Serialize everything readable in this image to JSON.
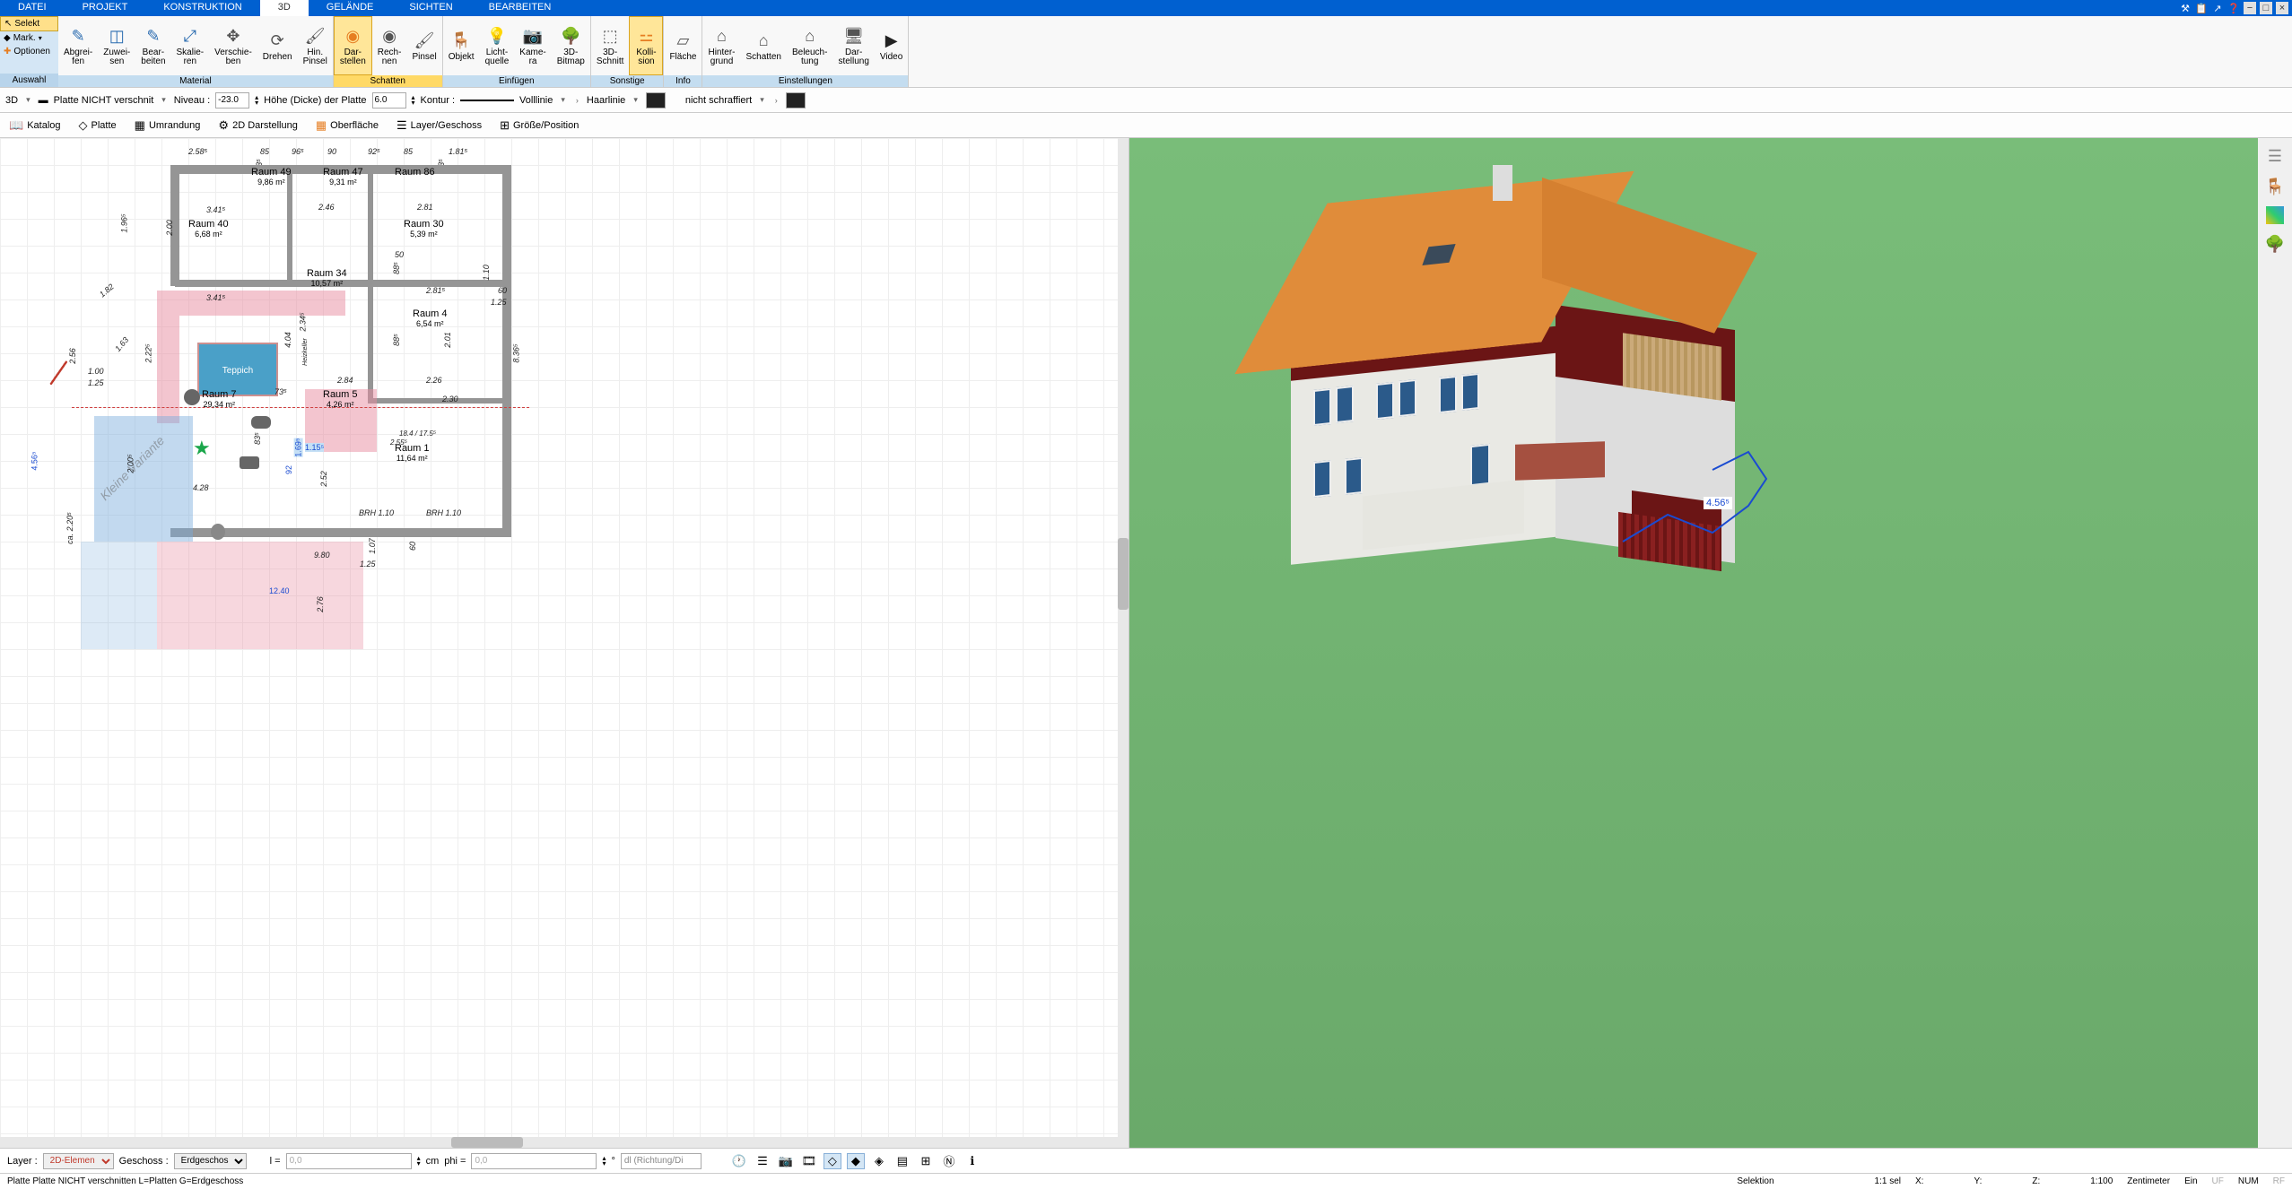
{
  "menu": {
    "datei": "DATEI",
    "projekt": "PROJEKT",
    "konstruktion": "KONSTRUKTION",
    "d3": "3D",
    "gelaende": "GELÄNDE",
    "sichten": "SICHTEN",
    "bearbeiten": "BEARBEITEN"
  },
  "side": {
    "selekt": "Selekt",
    "mark": "Mark.",
    "optionen": "Optionen",
    "auswahl": "Auswahl"
  },
  "ribbon": {
    "material": {
      "label": "Material",
      "abgreifen": "Abgrei-\nfen",
      "zuweisen": "Zuwei-\nsen",
      "bearbeiten": "Bear-\nbeiten",
      "skalieren": "Skalie-\nren",
      "verschieben": "Verschie-\nben",
      "drehen": "Drehen",
      "hinpinsel": "Hin.\nPinsel"
    },
    "schatten": {
      "label": "Schatten",
      "darstellen": "Dar-\nstellen",
      "rechnen": "Rech-\nnen",
      "pinsel": "Pinsel"
    },
    "einfuegen": {
      "label": "Einfügen",
      "objekt": "Objekt",
      "lichtquelle": "Licht-\nquelle",
      "kamera": "Kame-\nra",
      "bitmap3d": "3D-\nBitmap"
    },
    "sonstige": {
      "label": "Sonstige",
      "schnitt3d": "3D-\nSchnitt",
      "kollision": "Kolli-\nsion"
    },
    "info": {
      "label": "Info",
      "flaeche": "Fläche"
    },
    "einstellungen": {
      "label": "Einstellungen",
      "hintergrund": "Hinter-\ngrund",
      "schatten2": "Schatten",
      "beleuchtung": "Beleuch-\ntung",
      "darstellung": "Dar-\nstellung",
      "video": "Video"
    }
  },
  "props": {
    "d3": "3D",
    "platte": "Platte NICHT verschnit",
    "niveau": "Niveau :",
    "niveau_val": "-23.0",
    "hoehe": "Höhe (Dicke) der Platte",
    "hoehe_val": "6.0",
    "kontur": "Kontur :",
    "volllinie": "Volllinie",
    "haarlinie": "Haarlinie",
    "nicht_schraff": "nicht schraffiert"
  },
  "tabs": {
    "katalog": "Katalog",
    "platte": "Platte",
    "umrandung": "Umrandung",
    "darstellung2d": "2D Darstellung",
    "oberflaeche": "Oberfläche",
    "layergeschoss": "Layer/Geschoss",
    "groesseposition": "Größe/Position"
  },
  "plan": {
    "teppich": "Teppich",
    "variante": "Kleine\nVariante",
    "rooms": {
      "r40": {
        "name": "Raum 40",
        "area": "6,68 m²"
      },
      "r47": {
        "name": "Raum 47",
        "area": "9,31 m²"
      },
      "r49": {
        "name": "Raum 49",
        "area": "9,86 m²"
      },
      "r86": {
        "name": "Raum 86",
        "area": ""
      },
      "r30": {
        "name": "Raum 30",
        "area": "5,39 m²"
      },
      "r34": {
        "name": "Raum 34",
        "area": "10,57 m²"
      },
      "r4": {
        "name": "Raum 4",
        "area": "6,54 m²"
      },
      "r5": {
        "name": "Raum 5",
        "area": "4,26 m²"
      },
      "r1": {
        "name": "Raum 1",
        "area": "11,64 m²"
      },
      "r7": {
        "name": "Raum 7",
        "area": "29,34 m²"
      }
    },
    "dims": {
      "d258": "2.58⁵",
      "d85a": "85",
      "d96": "96⁵",
      "d90": "90",
      "d92": "92⁵",
      "d85b": "85",
      "d181": "1.81⁵",
      "d341": "3.41⁵",
      "d246": "2.46",
      "d281": "2.81",
      "d200": "2.00",
      "d196": "1.96⁵",
      "d182": "1.82",
      "d456": "4.56⁵",
      "d404": "4.04",
      "d234": "2.34⁵",
      "d284": "2.84",
      "d226": "2.26",
      "d230": "2.30",
      "d201": "2.01",
      "d125a": "1.25",
      "d163": "1.63",
      "d225": "2.22⁵",
      "d256": "2.56",
      "d100": "1.00",
      "d125b": "1.25",
      "d428": "4.28",
      "d980": "9.80",
      "d1240": "12.40",
      "d252": "2.52",
      "d107": "1.07",
      "d60": "60",
      "d276": "2.76",
      "d836": "8.36⁵",
      "d53a": "53⁵",
      "d53b": "53⁵",
      "d110": "1.10",
      "d83": "83⁵",
      "d73": "73⁵",
      "d125c": "1.25",
      "brh110a": "BRH 1.10",
      "brh110b": "BRH 1.10",
      "d200b": "2.00⁵",
      "d88a": "88⁵",
      "d88b": "88⁵",
      "heizk": "Heizkeller",
      "d169": "1.69⁵",
      "d115": "1.15⁵",
      "d184": "18.4 / 17.5⁵",
      "d255": "2.55⁵",
      "d50": "50",
      "d220": "ca. 2.20⁵",
      "d92b": "92",
      "d341b": "3.41⁵",
      "d281b": "2.81⁵"
    },
    "dim3d_val": "4.56⁵"
  },
  "status1": {
    "layer": "Layer :",
    "layer_val": "2D-Elemen",
    "geschoss": "Geschoss :",
    "geschoss_val": "Erdgeschos",
    "l": "l =",
    "l_val": "0,0",
    "cm": "cm",
    "phi": "phi =",
    "phi_val": "0,0",
    "deg": "°",
    "dl": "dl (Richtung/Di"
  },
  "status2": {
    "msg": "Platte Platte NICHT verschnitten L=Platten G=Erdgeschoss",
    "selektion": "Selektion",
    "sel": "1:1 sel",
    "x": "X:",
    "y": "Y:",
    "z": "Z:",
    "scale": "1:100",
    "unit": "Zentimeter",
    "ein": "Ein",
    "uf": "UF",
    "num": "NUM",
    "rf": "RF"
  }
}
